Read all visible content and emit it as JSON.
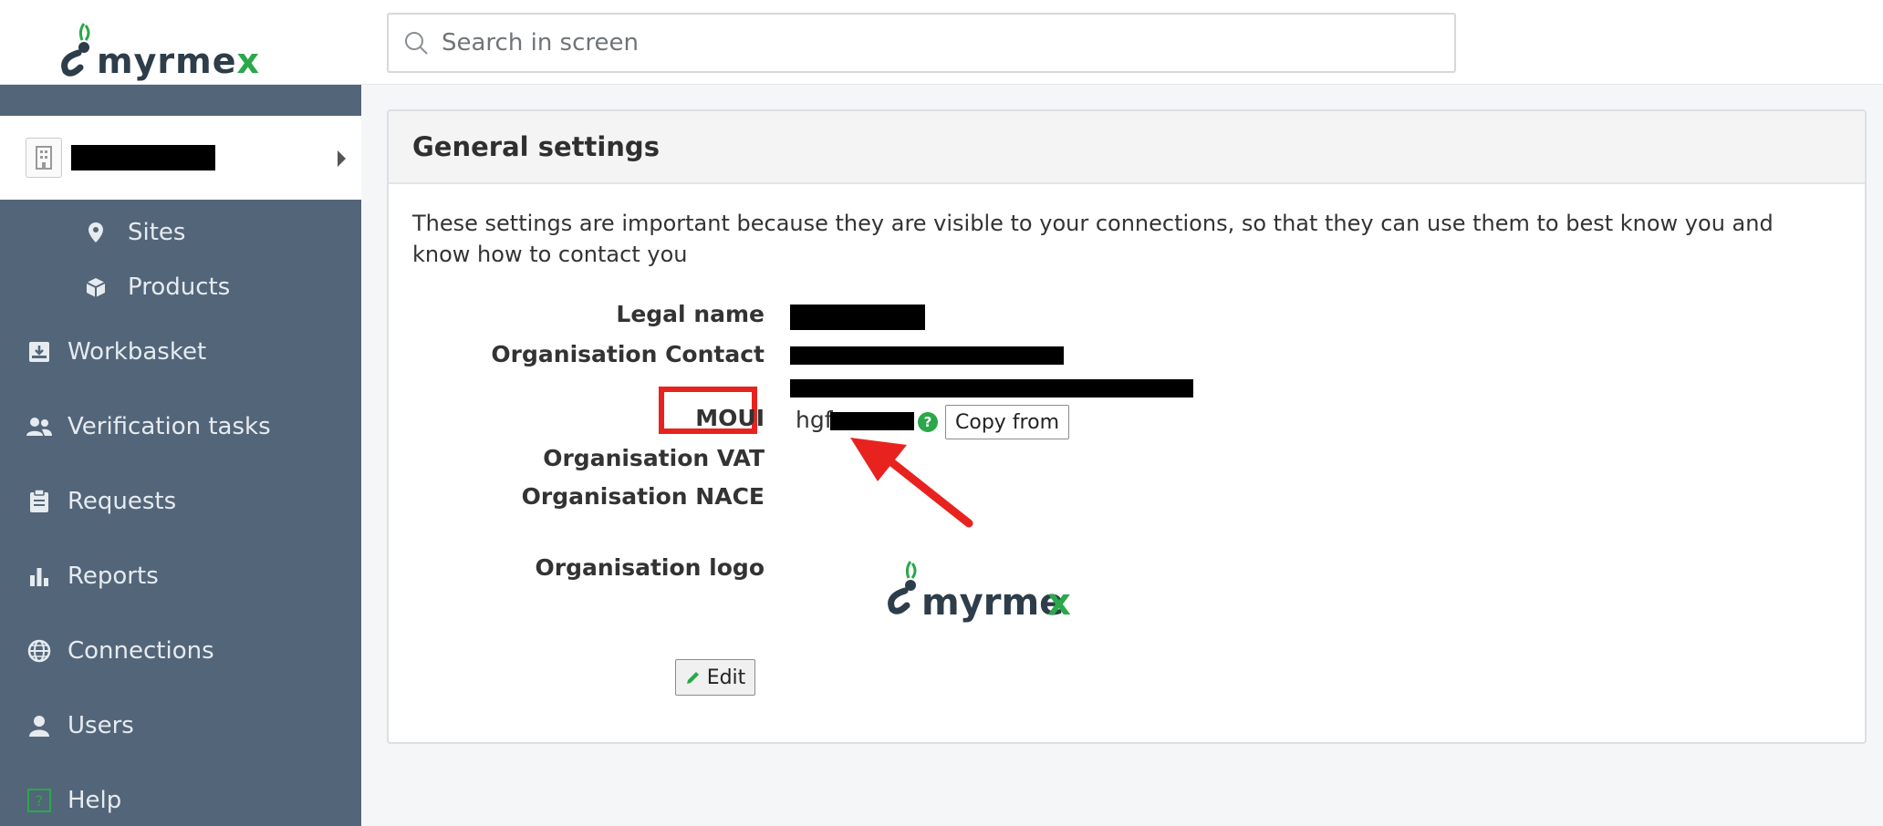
{
  "app": {
    "logo_text_main": "myrme",
    "logo_text_x": "x",
    "accent_color": "#2aa84a",
    "sidebar_color": "#536579"
  },
  "search": {
    "placeholder": "Search in screen"
  },
  "sidebar": {
    "org_icon": "building-icon",
    "items": [
      {
        "label": "Sites",
        "icon": "map-pin-icon"
      },
      {
        "label": "Products",
        "icon": "box-icon"
      },
      {
        "label": "Workbasket",
        "icon": "inbox-icon"
      },
      {
        "label": "Verification tasks",
        "icon": "users-icon"
      },
      {
        "label": "Requests",
        "icon": "clipboard-icon"
      },
      {
        "label": "Reports",
        "icon": "bar-chart-icon"
      },
      {
        "label": "Connections",
        "icon": "globe-icon"
      },
      {
        "label": "Users",
        "icon": "user-icon"
      },
      {
        "label": "Help",
        "icon": "help-icon"
      }
    ]
  },
  "panel": {
    "title": "General settings",
    "description": "These settings are important because they are visible to your connections, so that they can use them to best know you and know how to contact you",
    "fields": {
      "legal_name_label": "Legal name",
      "org_contact_label": "Organisation Contact",
      "moui_label": "MOUI",
      "moui_value_prefix": "hgf",
      "org_vat_label": "Organisation VAT",
      "org_nace_label": "Organisation NACE",
      "org_logo_label": "Organisation logo"
    },
    "copy_from_label": "Copy from",
    "edit_label": "Edit",
    "help_glyph": "?",
    "annotation_color": "#e8231f"
  }
}
